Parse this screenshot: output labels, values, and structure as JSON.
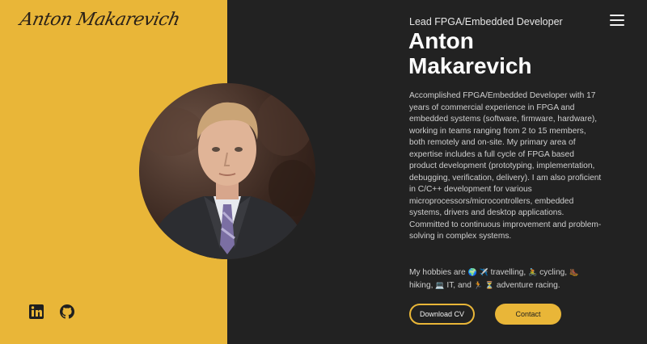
{
  "logo": {
    "text": "Anton Makarevich"
  },
  "header": {
    "subtitle": "Lead FPGA/Embedded Developer",
    "name": "Anton Makarevich",
    "menu_icon": "hamburger-menu-icon"
  },
  "bio": "Accomplished FPGA/Embedded Developer with 17 years of commercial experience in FPGA and embedded systems (software, firmware, hardware), working in teams ranging from 2 to 15 members, both remotely and on-site. My primary area of expertise includes a full cycle of FPGA based product development (prototyping, implementation, debugging, verification, delivery). I am also proficient in C/C++ development for various microprocessors/microcontrollers, embedded systems, drivers and desktop applications. Committed to continuous improvement and problem-solving in complex systems.",
  "hobbies": {
    "prefix": "My hobbies are",
    "travelling_emoji": "🌍 ✈️",
    "travelling": "travelling,",
    "cycling_emoji": "🚴",
    "cycling": "cycling,",
    "hiking_emoji": "🥾",
    "hiking": "hiking,",
    "it_emoji": "💻",
    "it": "IT, and",
    "racing_emoji": "🏃 ⏳",
    "racing": "adventure racing."
  },
  "buttons": {
    "download_cv": "Download CV",
    "contact": "Contact"
  },
  "social": {
    "icons": [
      "linkedin-icon",
      "github-icon"
    ]
  },
  "colors": {
    "accent": "#e9b638",
    "background_dark": "#222222",
    "text_light": "#ffffff"
  }
}
